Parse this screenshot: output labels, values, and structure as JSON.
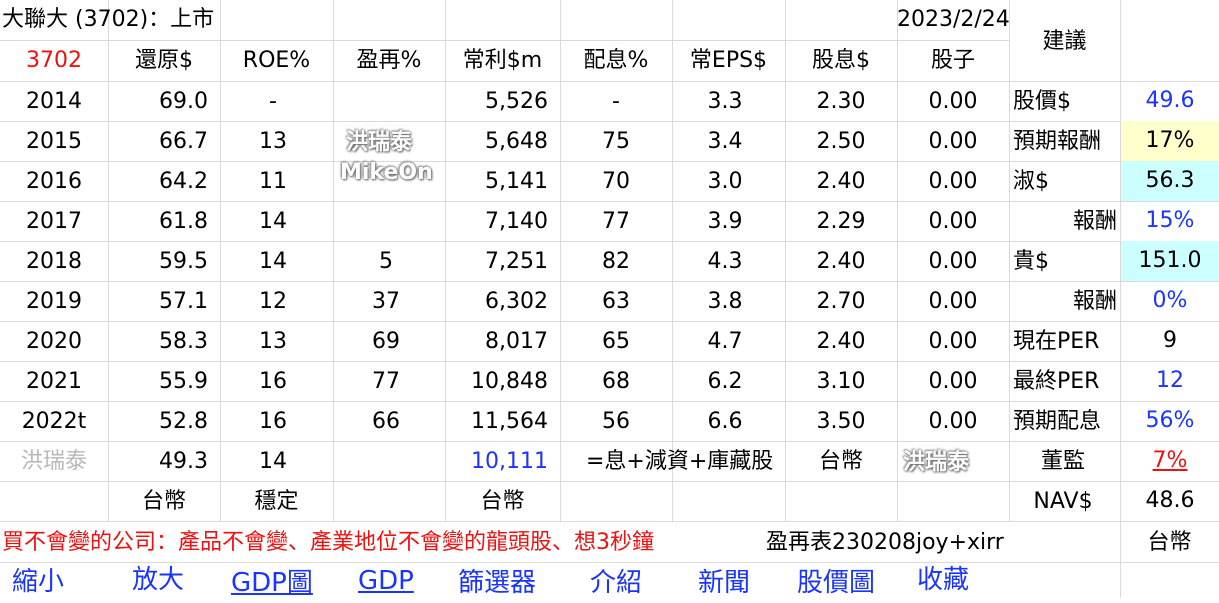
{
  "title": "大聯大 (3702)：上市",
  "date": "2023/2/24",
  "advice_header": "建議",
  "header": {
    "code": "3702",
    "cols": [
      "還原$",
      "ROE%",
      "盈再%",
      "常利$m",
      "配息%",
      "常EPS$",
      "股息$",
      "股子"
    ]
  },
  "rows": [
    {
      "year": "2014",
      "adj": "69.0",
      "roe": "-",
      "reinv": "",
      "profit": "5,526",
      "payout": "-",
      "eps": "3.3",
      "div": "2.30",
      "stock_div": "0.00"
    },
    {
      "year": "2015",
      "adj": "66.7",
      "roe": "13",
      "reinv": "",
      "profit": "5,648",
      "payout": "75",
      "eps": "3.4",
      "div": "2.50",
      "stock_div": "0.00"
    },
    {
      "year": "2016",
      "adj": "64.2",
      "roe": "11",
      "reinv": "",
      "profit": "5,141",
      "payout": "70",
      "eps": "3.0",
      "div": "2.40",
      "stock_div": "0.00"
    },
    {
      "year": "2017",
      "adj": "61.8",
      "roe": "14",
      "reinv": "",
      "profit": "7,140",
      "payout": "77",
      "eps": "3.9",
      "div": "2.29",
      "stock_div": "0.00"
    },
    {
      "year": "2018",
      "adj": "59.5",
      "roe": "14",
      "reinv": "5",
      "profit": "7,251",
      "payout": "82",
      "eps": "4.3",
      "div": "2.40",
      "stock_div": "0.00"
    },
    {
      "year": "2019",
      "adj": "57.1",
      "roe": "12",
      "reinv": "37",
      "profit": "6,302",
      "payout": "63",
      "eps": "3.8",
      "div": "2.70",
      "stock_div": "0.00"
    },
    {
      "year": "2020",
      "adj": "58.3",
      "roe": "13",
      "reinv": "69",
      "profit": "8,017",
      "payout": "65",
      "eps": "4.7",
      "div": "2.40",
      "stock_div": "0.00"
    },
    {
      "year": "2021",
      "adj": "55.9",
      "roe": "16",
      "reinv": "77",
      "profit": "10,848",
      "payout": "68",
      "eps": "6.2",
      "div": "3.10",
      "stock_div": "0.00"
    },
    {
      "year": "2022t",
      "adj": "52.8",
      "roe": "16",
      "reinv": "66",
      "profit": "11,564",
      "payout": "56",
      "eps": "6.6",
      "div": "3.50",
      "stock_div": "0.00"
    }
  ],
  "summary_row": {
    "author": "洪瑞泰",
    "adj": "49.3",
    "roe": "14",
    "profit": "10,111",
    "formula": "=息+減資+庫藏股",
    "currency": "台幣"
  },
  "unit_row": {
    "adj_unit": "台幣",
    "roe_note": "穩定",
    "profit_unit": "台幣"
  },
  "side": [
    {
      "label": "股價$",
      "value": "49.6"
    },
    {
      "label": "預期報酬",
      "value": "17%"
    },
    {
      "label": "淑$",
      "value": "56.3"
    },
    {
      "label": "報酬",
      "value": "15%"
    },
    {
      "label": "貴$",
      "value": "151.0"
    },
    {
      "label": "報酬",
      "value": "0%"
    },
    {
      "label": "現在PER",
      "value": "9"
    },
    {
      "label": "最終PER",
      "value": "12"
    },
    {
      "label": "預期配息",
      "value": "56%"
    },
    {
      "label": "董監",
      "value": "7%"
    },
    {
      "label": "NAV$",
      "value": "48.6"
    }
  ],
  "slogan": "買不會變的公司：產品不會變、產業地位不會變的龍頭股、想3秒鐘",
  "overlay_text": "盈再表230208joy+xirr",
  "currency_right": "台幣",
  "links": [
    "縮小",
    "放大",
    "GDP圖",
    "GDP",
    "篩選器",
    "介紹",
    "新聞",
    "股價圖",
    "收藏"
  ],
  "watermarks": [
    "洪瑞泰",
    "MikeOn"
  ],
  "colors": {
    "code_red": "#ee1111",
    "link_blue": "#1a35ff",
    "highlight_yellow": "#ffffcc",
    "highlight_cyan": "#ccffff",
    "gray_text": "#b8b8b8"
  }
}
